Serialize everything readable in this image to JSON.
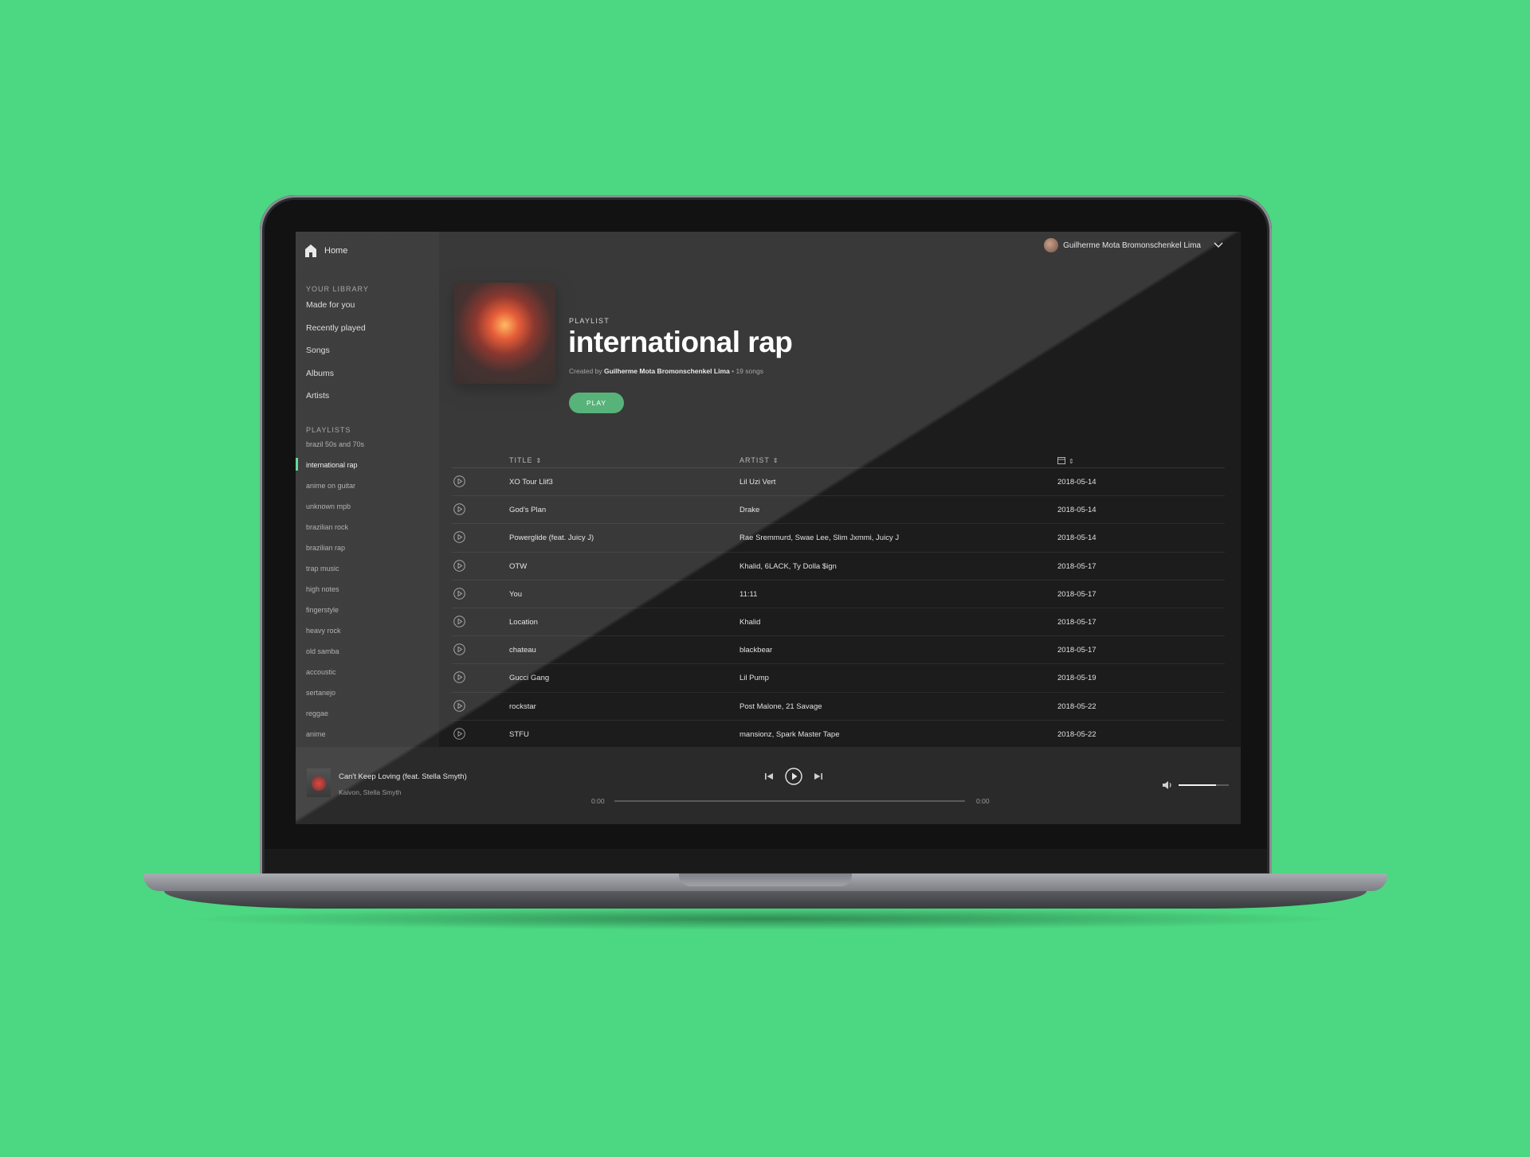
{
  "sidebar": {
    "home_label": "Home",
    "library_heading": "YOUR LIBRARY",
    "library_items": [
      "Made for you",
      "Recently played",
      "Songs",
      "Albums",
      "Artists"
    ],
    "playlists_heading": "PLAYLISTS",
    "playlists": [
      "brazil 50s and 70s",
      "international rap",
      "anime on guitar",
      "unknown mpb",
      "brazilian rock",
      "brazilian rap",
      "trap music",
      "high notes",
      "fingerstyle",
      "heavy rock",
      "old samba",
      "accoustic",
      "sertanejo",
      "reggae",
      "anime"
    ],
    "active_playlist": "international rap"
  },
  "user": {
    "name": "Guilherme Mota Bromonschenkel Lima"
  },
  "playlist": {
    "type_label": "PLAYLIST",
    "title": "international rap",
    "created_by_prefix": "Created by",
    "creator": "Guilherme Mota Bromonschenkel Lima",
    "song_count": "• 19 songs",
    "play_label": "PLAY"
  },
  "table": {
    "columns": {
      "title": "TITLE",
      "artist": "ARTIST",
      "date_icon": "calendar-icon"
    },
    "rows": [
      {
        "title": "XO Tour Llif3",
        "artist": "Lil Uzi Vert",
        "date": "2018-05-14"
      },
      {
        "title": "God's Plan",
        "artist": "Drake",
        "date": "2018-05-14"
      },
      {
        "title": "Powerglide (feat. Juicy J)",
        "artist": "Rae Sremmurd, Swae Lee, Slim Jxmmi, Juicy J",
        "date": "2018-05-14"
      },
      {
        "title": "OTW",
        "artist": "Khalid, 6LACK, Ty Dolla $ign",
        "date": "2018-05-17"
      },
      {
        "title": "You",
        "artist": "11:11",
        "date": "2018-05-17"
      },
      {
        "title": "Location",
        "artist": "Khalid",
        "date": "2018-05-17"
      },
      {
        "title": "chateau",
        "artist": "blackbear",
        "date": "2018-05-17"
      },
      {
        "title": "Gucci Gang",
        "artist": "Lil Pump",
        "date": "2018-05-19"
      },
      {
        "title": "rockstar",
        "artist": "Post Malone, 21 Savage",
        "date": "2018-05-22"
      },
      {
        "title": "STFU",
        "artist": "mansionz, Spark Master Tape",
        "date": "2018-05-22"
      }
    ]
  },
  "player": {
    "track_title": "Can't Keep Loving (feat. Stella Smyth)",
    "track_artist": "Kaivon, Stella Smyth",
    "time_elapsed": "0:00",
    "time_total": "0:00",
    "progress_fraction": 0,
    "volume_fraction": 0.75
  },
  "colors": {
    "accent": "#4cd782",
    "background": "#4cd782",
    "play_button": "#3ea865"
  }
}
